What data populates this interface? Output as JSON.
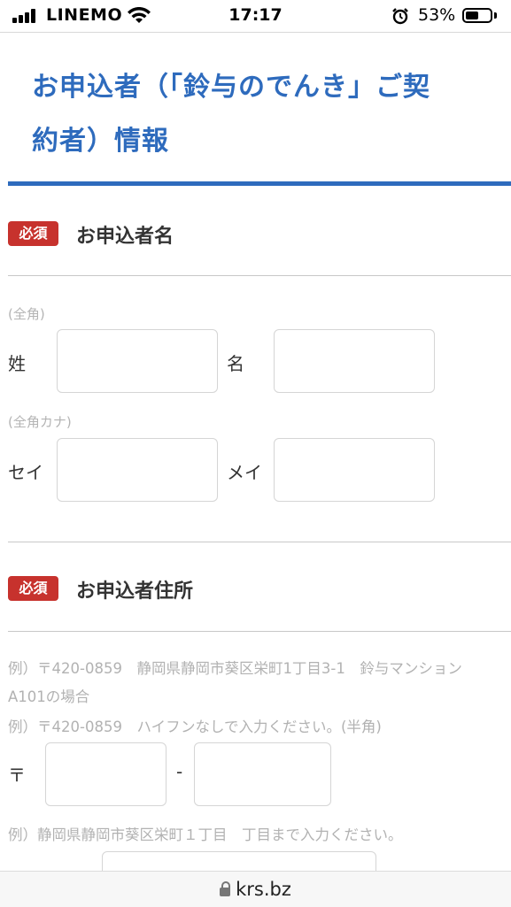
{
  "status_bar": {
    "carrier": "LINEMO",
    "time": "17:17",
    "battery_percent": "53%",
    "battery_level": 0.53
  },
  "page": {
    "title_line1": "お申込者（「鈴与のでんき」ご契",
    "title_line2": "約者）情報"
  },
  "sections": {
    "name": {
      "badge": "必須",
      "label": "お申込者名",
      "hint_kanji": "(全角)",
      "last_name_label": "姓",
      "first_name_label": "名",
      "hint_kana": "(全角カナ)",
      "last_kana_label": "セイ",
      "first_kana_label": "メイ"
    },
    "address": {
      "badge": "必須",
      "label": "お申込者住所",
      "example_line1": "例）〒420-0859　静岡県静岡市葵区栄町1丁目3-1　鈴与マンション",
      "example_line2": "A101の場合",
      "example_postal": "例）〒420-0859　ハイフンなしで入力ください。(半角)",
      "postal_mark": "〒",
      "postal_dash": "-",
      "example_city": "例）静岡県静岡市葵区栄町１丁目　丁目まで入力ください。"
    }
  },
  "browser": {
    "url": "krs.bz"
  }
}
